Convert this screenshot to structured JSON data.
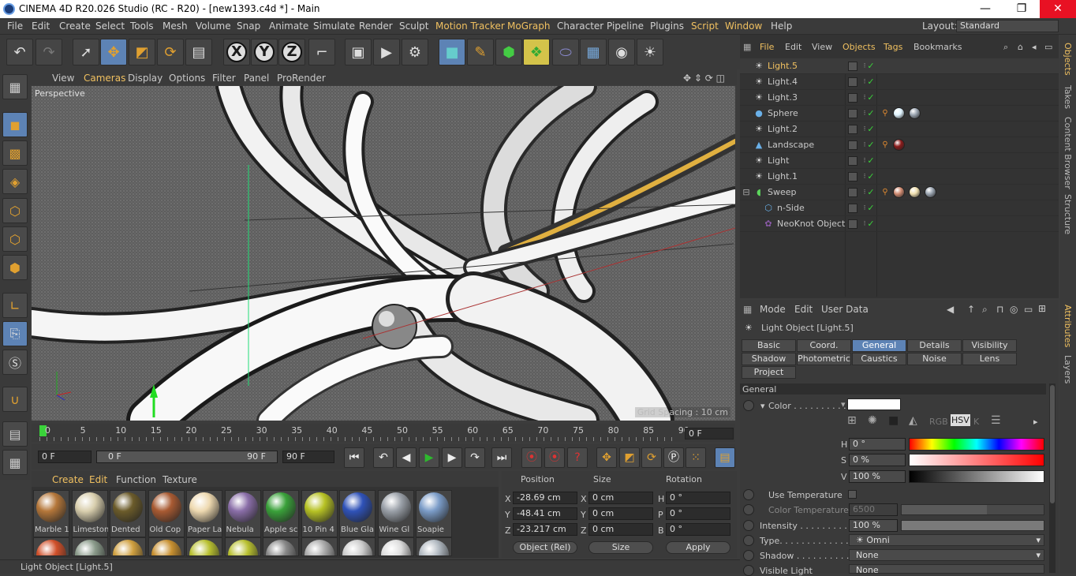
{
  "window": {
    "title": "CINEMA 4D R20.026 Studio (RC - R20) - [new1393.c4d *] - Main",
    "minimize": "—",
    "restore": "❐",
    "close": "✕"
  },
  "menu": [
    "File",
    "Edit",
    "Create",
    "Select",
    "Tools",
    "Mesh",
    "Volume",
    "Snap",
    "Animate",
    "Simulate",
    "Render",
    "Sculpt",
    "Motion Tracker",
    "MoGraph",
    "Character",
    "Pipeline",
    "Plugins",
    "Script",
    "Window",
    "Help"
  ],
  "layout": {
    "label": "Layout:",
    "value": "Standard"
  },
  "viewport": {
    "menu": [
      "View",
      "Cameras",
      "Display",
      "Options",
      "Filter",
      "Panel",
      "ProRender"
    ],
    "label": "Perspective",
    "grid_spacing": "Grid Spacing : 10 cm"
  },
  "timeline": {
    "ticks": [
      "0",
      "5",
      "10",
      "15",
      "20",
      "25",
      "30",
      "35",
      "40",
      "45",
      "50",
      "55",
      "60",
      "65",
      "70",
      "75",
      "80",
      "85",
      "90"
    ],
    "current": "0 F"
  },
  "transport": {
    "start": "0 F",
    "range_start": "0 F",
    "range_end": "90 F",
    "end": "90 F"
  },
  "materials": {
    "menu": [
      "Create",
      "Edit",
      "Function",
      "Texture"
    ],
    "items": [
      {
        "label": "Marble 1",
        "color": "#b5773a"
      },
      {
        "label": "Limestone",
        "color": "#d9cfae"
      },
      {
        "label": "Dented",
        "color": "#6b5b2a"
      },
      {
        "label": "Old Cop",
        "color": "#a85a32"
      },
      {
        "label": "Paper La",
        "color": "#eed9b0"
      },
      {
        "label": "Nebula",
        "color": "#8a6ea8"
      },
      {
        "label": "Apple sc",
        "color": "#3aa13a"
      },
      {
        "label": "10 Pin 4",
        "color": "#b7c224"
      },
      {
        "label": "Blue Gla",
        "color": "#2f52b8"
      },
      {
        "label": "Wine Gl",
        "color": "#9aa0a8"
      },
      {
        "label": "Soapie",
        "color": "#7b9cc8"
      }
    ],
    "row2_colors": [
      "#d0502a",
      "#8a9a8a",
      "#d0a040",
      "#c89030",
      "#b8c030",
      "#b8c030",
      "#888",
      "#aaa",
      "#ccc",
      "#ddd",
      "#b0b8c0"
    ]
  },
  "coords": {
    "headers": {
      "position": "Position",
      "size": "Size",
      "rotation": "Rotation"
    },
    "rows": [
      {
        "axis": "X",
        "pos": "-28.69 cm",
        "size_axis": "X",
        "size": "0 cm",
        "rot_axis": "H",
        "rot": "0 °"
      },
      {
        "axis": "Y",
        "pos": "-48.41 cm",
        "size_axis": "Y",
        "size": "0 cm",
        "rot_axis": "P",
        "rot": "0 °"
      },
      {
        "axis": "Z",
        "pos": "-23.217 cm",
        "size_axis": "Z",
        "size": "0 cm",
        "rot_axis": "B",
        "rot": "0 °"
      }
    ],
    "mode": "Object (Rel)",
    "size_mode": "Size",
    "apply": "Apply"
  },
  "status": "Light Object [Light.5]",
  "objects": {
    "menu": [
      "File",
      "Edit",
      "View",
      "Objects",
      "Tags",
      "Bookmarks"
    ],
    "items": [
      {
        "name": "Light.5",
        "icon": "light-icon",
        "selected": true
      },
      {
        "name": "Light.4",
        "icon": "light-icon"
      },
      {
        "name": "Light.3",
        "icon": "light-icon"
      },
      {
        "name": "Sphere",
        "icon": "sphere-icon"
      },
      {
        "name": "Light.2",
        "icon": "light-icon"
      },
      {
        "name": "Landscape",
        "icon": "landscape-icon"
      },
      {
        "name": "Light",
        "icon": "light-icon"
      },
      {
        "name": "Light.1",
        "icon": "light-icon"
      },
      {
        "name": "Sweep",
        "icon": "sweep-icon"
      },
      {
        "name": "n-Side",
        "icon": "nside-icon"
      },
      {
        "name": "NeoKnot Object",
        "icon": "neoknot-icon"
      }
    ]
  },
  "right_tabs": [
    "Objects",
    "Takes",
    "Content Browser",
    "Structure",
    "Attributes",
    "Layers"
  ],
  "attributes": {
    "menu": [
      "Mode",
      "Edit",
      "User Data"
    ],
    "object_title": "Light Object [Light.5]",
    "tabs_row1": [
      "Basic",
      "Coord.",
      "General",
      "Details",
      "Visibility"
    ],
    "tabs_row2": [
      "Shadow",
      "Photometric",
      "Caustics",
      "Noise",
      "Lens"
    ],
    "tabs_row3": [
      "Project"
    ],
    "section": "General",
    "color_label": "Color . . . . . . . . . .",
    "h_label": "H",
    "h_value": "0 °",
    "s_label": "S",
    "s_value": "0 %",
    "v_label": "V",
    "v_value": "100 %",
    "color_modes": [
      "RGB",
      "HSV",
      "K"
    ],
    "use_temperature": "Use Temperature",
    "color_temperature": "Color Temperature",
    "temperature_value": "6500",
    "intensity_label": "Intensity . . . . . . . . . .",
    "intensity_value": "100 %",
    "type_label": "Type. . . . . . . . . . . . .",
    "type_value": "Omni",
    "shadow_label": "Shadow . . . . . . . . . .",
    "shadow_value": "None",
    "visible_light_label": "Visible Light",
    "visible_light_value": "None"
  }
}
